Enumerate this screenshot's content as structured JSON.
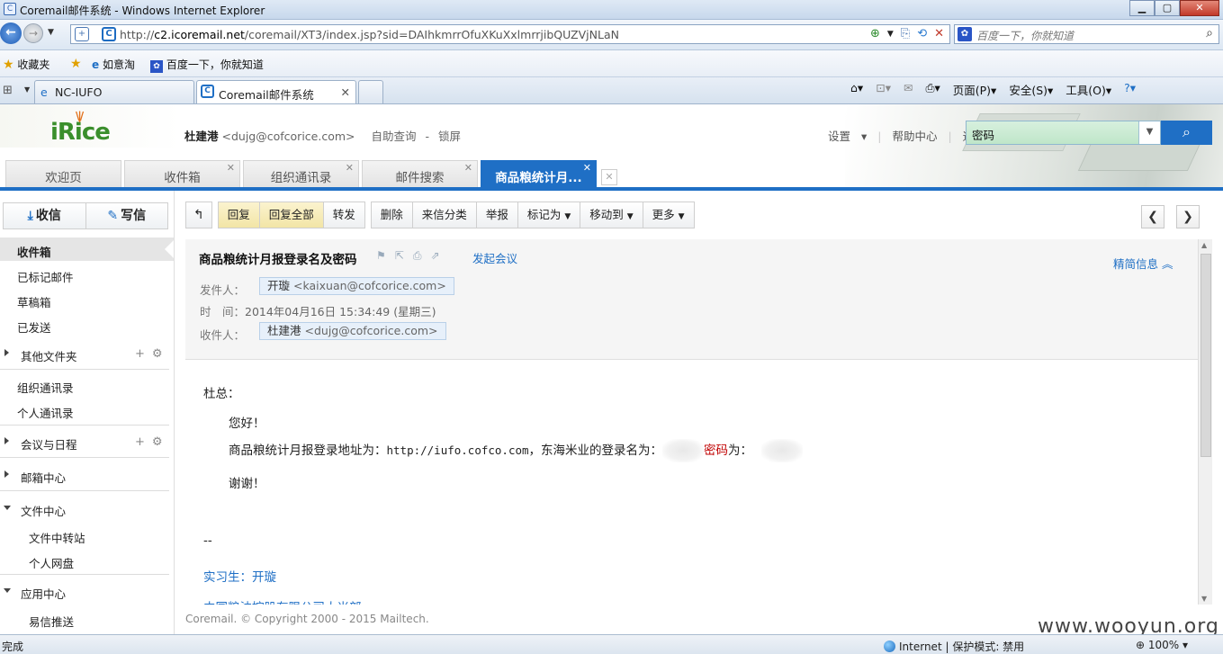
{
  "browser": {
    "window_title": "Coremail邮件系统 - Windows Internet Explorer",
    "url_host": "c2.icoremail.net",
    "url_prefix": "http://",
    "url_path": "/coremail/XT3/index.jsp?sid=DAIhkmrrOfuXKuXxlmrrjibQUZVjNLaN",
    "search_placeholder": "百度一下，你就知道",
    "favorites": {
      "label": "收藏夹",
      "items": [
        "如意淘",
        "百度一下，你就知道"
      ]
    },
    "tabs": [
      "NC-IUFO",
      "Coremail邮件系统"
    ],
    "tools": {
      "page": "页面(P)",
      "safety": "安全(S)",
      "tools": "工具(O)"
    },
    "status_left": "完成",
    "status_zone": "Internet | 保护模式: 禁用",
    "zoom": "100%"
  },
  "header": {
    "logo_text": "iRice",
    "user_name": "杜建港",
    "user_email": "<dujg@cofcorice.com>",
    "links": [
      "自助查询",
      "-",
      "锁屏"
    ],
    "settings": "设置",
    "help": "帮助中心",
    "logout": "退出",
    "search_value": "密码"
  },
  "app_tabs": [
    {
      "label": "欢迎页"
    },
    {
      "label": "收件箱"
    },
    {
      "label": "组织通讯录"
    },
    {
      "label": "邮件搜索"
    },
    {
      "label": "商品粮统计月..."
    }
  ],
  "sidebar": {
    "receive": "收信",
    "write": "写信",
    "items": {
      "inbox": "收件箱",
      "flagged": "已标记邮件",
      "drafts": "草稿箱",
      "sent": "已发送",
      "other_folders": "其他文件夹",
      "org_contacts": "组织通讯录",
      "personal_contacts": "个人通讯录",
      "meetings": "会议与日程",
      "mailbox_center": "邮箱中心",
      "file_center": "文件中心",
      "file_transfer": "文件中转站",
      "personal_disk": "个人网盘",
      "app_center": "应用中心",
      "yixin": "易信推送"
    }
  },
  "toolbar": {
    "back": "↰",
    "reply": "回复",
    "reply_all": "回复全部",
    "forward": "转发",
    "delete": "删除",
    "classify": "来信分类",
    "report": "举报",
    "mark_as": "标记为",
    "move_to": "移动到",
    "more": "更多"
  },
  "mail": {
    "subject": "商品粮统计月报登录名及密码",
    "start_meeting": "发起会议",
    "simple_info": "精简信息",
    "from_label": "发件人：",
    "from_name": "开璇",
    "from_email": "<kaixuan@cofcorice.com>",
    "time_label": "时　间：",
    "time_value": "2014年04月16日 15:34:49 (星期三)",
    "to_label": "收件人：",
    "to_name": "杜建港",
    "to_email": "<dujg@cofcorice.com>",
    "greeting": "杜总：",
    "hello": "您好！",
    "body_prefix": "商品粮统计月报登录地址为：",
    "body_url": "http://iufo.cofco.com",
    "body_mid": "，东海米业的登录名为：",
    "body_pw_word": "密码",
    "body_pw_suffix": "为：",
    "thanks": "谢谢！",
    "sig_sep": "--",
    "sig_name": "实习生：开璇",
    "sig_company": "中国粮油控股有限公司大米部"
  },
  "footer": "Coremail. © Copyright 2000 - 2015 Mailtech.",
  "watermark": "www.wooyun.org",
  "colors": {
    "accent": "#1f6fc5",
    "highlight_button": "#f2e5a6",
    "password_red": "#c00000"
  }
}
